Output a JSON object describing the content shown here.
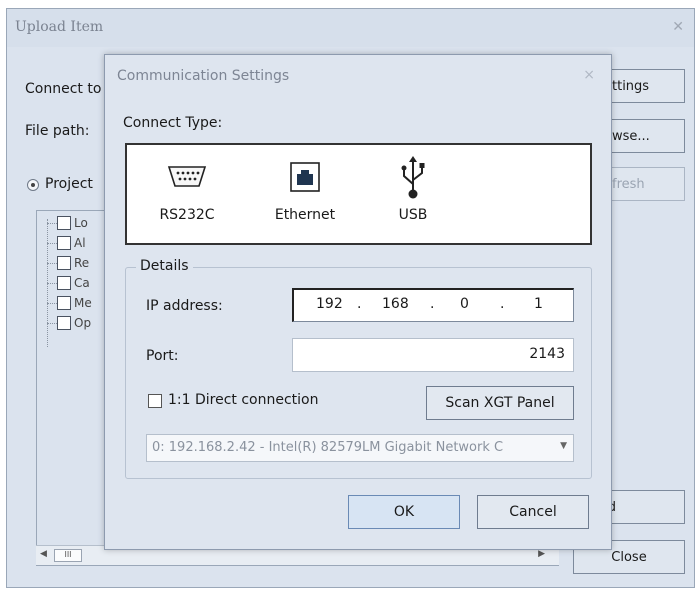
{
  "background_dialog": {
    "title": "Upload Item",
    "connect_to_label": "Connect to",
    "file_path_label": "File path:",
    "project_radio_label": "Project",
    "settings_button": "ettings",
    "browse_button": "owse...",
    "refresh_button": "efresh",
    "upload_button": "pload",
    "close_button": "Close",
    "tree_items": [
      "Lo",
      "Al",
      "Re",
      "Ca",
      "Me",
      "Op"
    ],
    "scroll_thumb": "III"
  },
  "dialog": {
    "title": "Communication Settings",
    "close_glyph": "×",
    "connect_type_label": "Connect Type:",
    "connect_types": [
      {
        "label": "RS232C",
        "icon": "serial-port-icon"
      },
      {
        "label": "Ethernet",
        "icon": "ethernet-port-icon"
      },
      {
        "label": "USB",
        "icon": "usb-icon"
      }
    ],
    "details_legend": "Details",
    "ip_label": "IP address:",
    "ip_octets": [
      "192",
      "168",
      "0",
      "1"
    ],
    "port_label": "Port:",
    "port_value": "2143",
    "direct_connection_label": "1:1 Direct connection",
    "direct_connection_checked": false,
    "scan_button": "Scan XGT Panel",
    "nic_selected": "0: 192.168.2.42 - Intel(R) 82579LM Gigabit Network C",
    "ok_button": "OK",
    "cancel_button": "Cancel"
  }
}
